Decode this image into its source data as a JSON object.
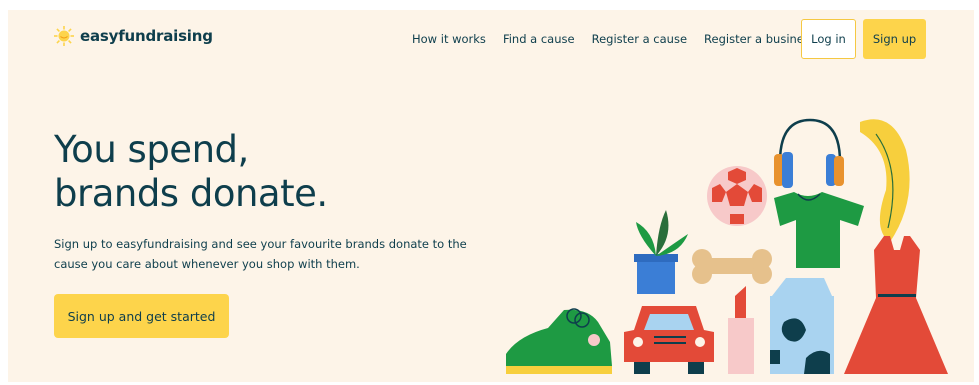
{
  "brand": {
    "name": "easyfundraising",
    "logo_icon": "sun-logo-icon",
    "colors": {
      "primary_text": "#0e3e4c",
      "accent": "#fdd44b",
      "background": "#fdf4e8"
    }
  },
  "nav": {
    "links": [
      "How it works",
      "Find a cause",
      "Register a cause",
      "Register a business"
    ],
    "login_label": "Log in",
    "signup_label": "Sign up"
  },
  "hero": {
    "title_line1": "You spend,",
    "title_line2": "brands donate.",
    "subtitle": "Sign up to easyfundraising and see your favourite brands donate to the cause you care about whenever you shop with them.",
    "cta_label": "Sign up and get started"
  },
  "illustration": {
    "icons": [
      "headphones-icon",
      "banana-icon",
      "football-icon",
      "tshirt-icon",
      "plant-icon",
      "bone-icon",
      "dress-icon",
      "sneaker-icon",
      "car-icon",
      "lipstick-icon",
      "milk-carton-icon"
    ]
  }
}
